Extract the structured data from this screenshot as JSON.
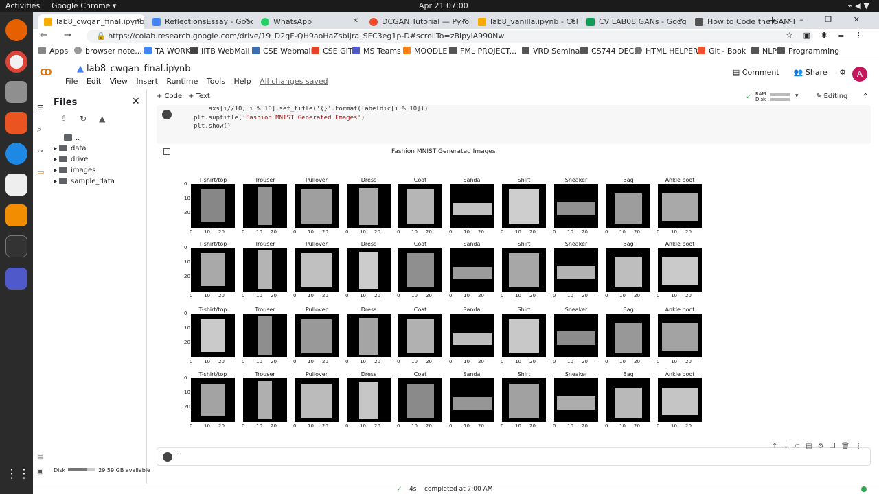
{
  "os": {
    "activities": "Activities",
    "app_name": "Google Chrome",
    "clock": "Apr 21  07:00"
  },
  "tabs": [
    {
      "title": "lab8_cwgan_final.ipynb",
      "color": "#f9ab00"
    },
    {
      "title": "ReflectionsEssay - Googl",
      "color": "#4285f4"
    },
    {
      "title": "WhatsApp",
      "color": "#25d366"
    },
    {
      "title": "DCGAN Tutorial — PyTor",
      "color": "#ee4c2c"
    },
    {
      "title": "lab8_vanilla.ipynb - Colab",
      "color": "#f9ab00"
    },
    {
      "title": "CV LAB08 GANs - Google",
      "color": "#0f9d58"
    },
    {
      "title": "How to Code the GAN Tra",
      "color": "#555555"
    }
  ],
  "address": {
    "url": "https://colab.research.google.com/drive/19_D2qF-QH9aoHaZsbIjra_SFC3eg1p-D#scrollTo=zBlpyiA990Nw"
  },
  "bookmarks": [
    "Apps",
    "browser note...",
    "TA WORK",
    "IITB WebMail",
    "CSE Webmail",
    "CSE GIT",
    "MS Teams",
    "MOODLE",
    "FML PROJECT...",
    "VRD Seminar",
    "CS744 DECS",
    "HTML HELPER",
    "Git - Book",
    "NLP",
    "Programming"
  ],
  "notebook": {
    "title": "lab8_cwgan_final.ipynb",
    "menu": [
      "File",
      "Edit",
      "View",
      "Insert",
      "Runtime",
      "Tools",
      "Help"
    ],
    "saved": "All changes saved",
    "comment": "Comment",
    "share": "Share",
    "avatar": "A"
  },
  "sidebar": {
    "title": "Files",
    "parent": "..",
    "items": [
      "data",
      "drive",
      "images",
      "sample_data"
    ],
    "disk_label": "Disk",
    "disk_avail": "29.59 GB available"
  },
  "toolbar": {
    "add_code": "+ Code",
    "add_text": "+ Text",
    "ram": "RAM",
    "disk": "Disk",
    "editing": "Editing"
  },
  "code": {
    "line1": "    axs[i//10, i % 10].set_title('{}'.format(labeldic[i % 10]))",
    "line2a": "plt.suptitle(",
    "line2b": "'Fashion MNIST Generated Images'",
    "line2c": ")",
    "line3": "plt.show()"
  },
  "chart_data": {
    "type": "image_grid",
    "title": "Fashion MNIST Generated Images",
    "rows": 4,
    "categories": [
      "T-shirt/top",
      "Trouser",
      "Pullover",
      "Dress",
      "Coat",
      "Sandal",
      "Shirt",
      "Sneaker",
      "Bag",
      "Ankle boot"
    ],
    "yticks": [
      "0",
      "10",
      "20"
    ],
    "xticks": [
      "0",
      "10",
      "20"
    ]
  },
  "status": {
    "seconds": "4s",
    "completed": "completed at 7:00 AM"
  }
}
